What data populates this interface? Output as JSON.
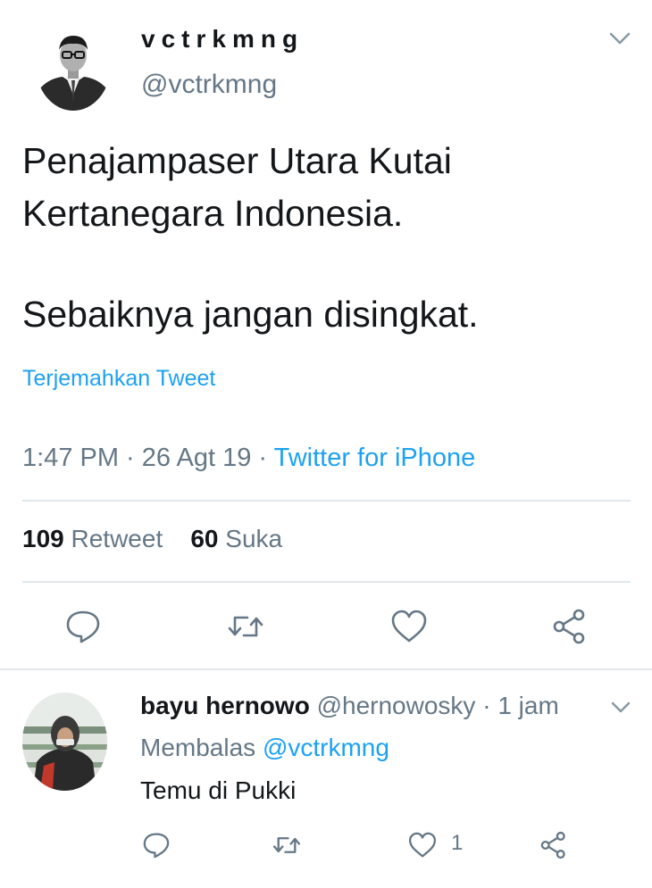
{
  "tweet": {
    "author": {
      "display_name": "vctrkmng",
      "handle": "@vctrkmng"
    },
    "text_lines": [
      "Penajampaser Utara Kutai",
      "Kertanegara Indonesia.",
      "Sebaiknya jangan disingkat."
    ],
    "translate_label": "Terjemahkan Tweet",
    "time": "1:47 PM",
    "date": "26 Agt 19",
    "separator": " · ",
    "source": "Twitter for iPhone",
    "retweet_count": "109",
    "retweet_label": "Retweet",
    "like_count": "60",
    "like_label": "Suka",
    "actions": [
      "reply-icon",
      "retweet-icon",
      "like-icon",
      "share-icon"
    ]
  },
  "reply": {
    "author": {
      "display_name": "bayu hernowo",
      "handle": "@hernowosky",
      "time": "1 jam"
    },
    "separator": " · ",
    "replying_prefix": "Membalas ",
    "replying_to": "@vctrkmng",
    "text": "Temu di Pukki",
    "like_count": "1"
  },
  "colors": {
    "accent": "#1da1f2",
    "secondary": "#657786",
    "text": "#14171a",
    "divider": "#e1e8ed"
  }
}
